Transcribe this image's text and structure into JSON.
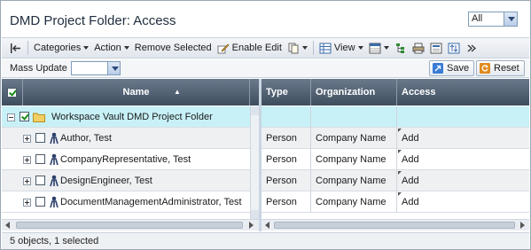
{
  "title": "DMD Project Folder: Access",
  "filter": {
    "selected": "All"
  },
  "toolbar": {
    "categories": "Categories",
    "action": "Action",
    "remove_selected": "Remove Selected",
    "enable_edit": "Enable Edit",
    "view": "View"
  },
  "mass_update": {
    "label": "Mass Update",
    "selected": ""
  },
  "buttons": {
    "save": "Save",
    "reset": "Reset"
  },
  "columns": {
    "name": "Name",
    "type": "Type",
    "organization": "Organization",
    "access": "Access"
  },
  "rows": [
    {
      "name": "Workspace Vault DMD Project Folder",
      "type": "",
      "organization": "",
      "access": "",
      "selected": true,
      "checked": true
    },
    {
      "name": "Author, Test",
      "type": "Person",
      "organization": "Company Name",
      "access": "Add",
      "selected": false,
      "checked": false
    },
    {
      "name": "CompanyRepresentative, Test",
      "type": "Person",
      "organization": "Company Name",
      "access": "Add",
      "selected": false,
      "checked": false
    },
    {
      "name": "DesignEngineer, Test",
      "type": "Person",
      "organization": "Company Name",
      "access": "Add",
      "selected": false,
      "checked": false
    },
    {
      "name": "DocumentManagementAdministrator, Test",
      "type": "Person",
      "organization": "Company Name",
      "access": "Add",
      "selected": false,
      "checked": false
    }
  ],
  "status": "5 objects, 1 selected",
  "colors": {
    "header": "#4e5e70",
    "selected_row": "#c8f1f7",
    "accent": "#2b4a78"
  }
}
